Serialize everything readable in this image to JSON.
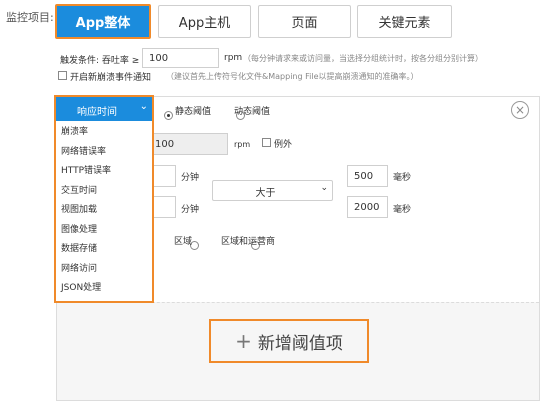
{
  "monitor_label": "监控项目:",
  "tabs": [
    "App整体",
    "App主机",
    "页面",
    "关键元素"
  ],
  "trigger": {
    "label": "触发条件: 吞吐率 ≥",
    "value": "100",
    "unit": "rpm",
    "hint": "（每分钟请求来或访问量，当选择分组统计时，按各分组分别计算）"
  },
  "crash_notify": {
    "label": "开启新崩溃事件通知",
    "hint": "（建议首先上传符号化文件&Mapping File以提高崩溃通知的准确率。）"
  },
  "metric_select": {
    "value": "响应时间"
  },
  "metric_options": [
    "崩溃率",
    "网络错误率",
    "HTTP错误率",
    "交互时间",
    "视图加载",
    "图像处理",
    "数据存储",
    "网络访问",
    "JSON处理"
  ],
  "threshold_type": {
    "static": "静态阈值",
    "dynamic": "动态阈值"
  },
  "throughput": {
    "value": "100",
    "unit": "rpm",
    "exclude": "例外"
  },
  "minutes_unit_1": "分钟",
  "minutes_unit_2": "分钟",
  "compare": "大于",
  "ms_value_1": "500",
  "ms_unit_1": "毫秒",
  "ms_value_2": "2000",
  "ms_unit_2": "毫秒",
  "scope": {
    "region": "区域",
    "region_carrier": "区域和运营商"
  },
  "add_threshold": {
    "icon": "+",
    "label": "新增阈值项"
  },
  "colors": {
    "primary": "#1b8cdd",
    "highlight": "#f08a2a"
  }
}
